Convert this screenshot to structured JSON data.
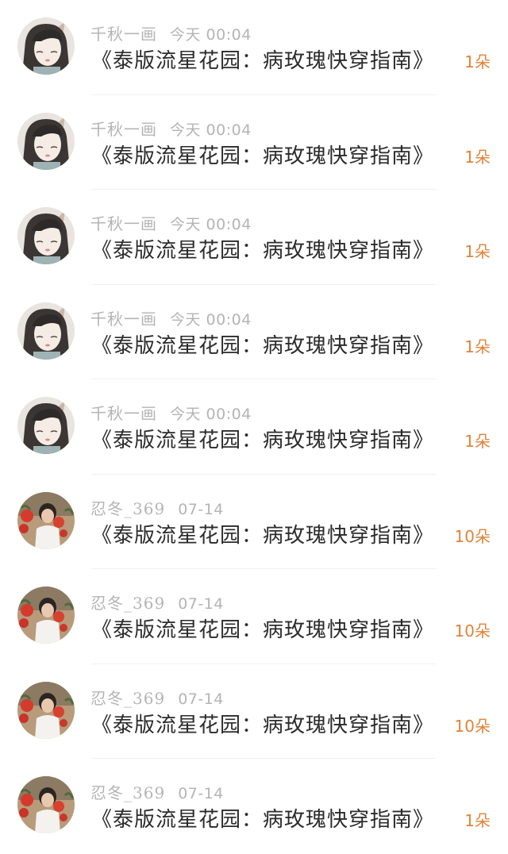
{
  "items": [
    {
      "user": "千秋一画",
      "time": "今天 00:04",
      "title": "《泰版流星花园：病玫瑰快穿指南》",
      "count": "1朵",
      "avatar": "avatar-a"
    },
    {
      "user": "千秋一画",
      "time": "今天 00:04",
      "title": "《泰版流星花园：病玫瑰快穿指南》",
      "count": "1朵",
      "avatar": "avatar-a"
    },
    {
      "user": "千秋一画",
      "time": "今天 00:04",
      "title": "《泰版流星花园：病玫瑰快穿指南》",
      "count": "1朵",
      "avatar": "avatar-a"
    },
    {
      "user": "千秋一画",
      "time": "今天 00:04",
      "title": "《泰版流星花园：病玫瑰快穿指南》",
      "count": "1朵",
      "avatar": "avatar-a"
    },
    {
      "user": "千秋一画",
      "time": "今天 00:04",
      "title": "《泰版流星花园：病玫瑰快穿指南》",
      "count": "1朵",
      "avatar": "avatar-a"
    },
    {
      "user": "忍冬_369",
      "time": "07-14",
      "title": "《泰版流星花园：病玫瑰快穿指南》",
      "count": "10朵",
      "avatar": "avatar-b"
    },
    {
      "user": "忍冬_369",
      "time": "07-14",
      "title": "《泰版流星花园：病玫瑰快穿指南》",
      "count": "10朵",
      "avatar": "avatar-b"
    },
    {
      "user": "忍冬_369",
      "time": "07-14",
      "title": "《泰版流星花园：病玫瑰快穿指南》",
      "count": "10朵",
      "avatar": "avatar-b"
    },
    {
      "user": "忍冬_369",
      "time": "07-14",
      "title": "《泰版流星花园：病玫瑰快穿指南》",
      "count": "1朵",
      "avatar": "avatar-b"
    }
  ],
  "colors": {
    "count": "#e0833a",
    "meta": "#b4b4b4",
    "title": "#2b2b2b"
  }
}
